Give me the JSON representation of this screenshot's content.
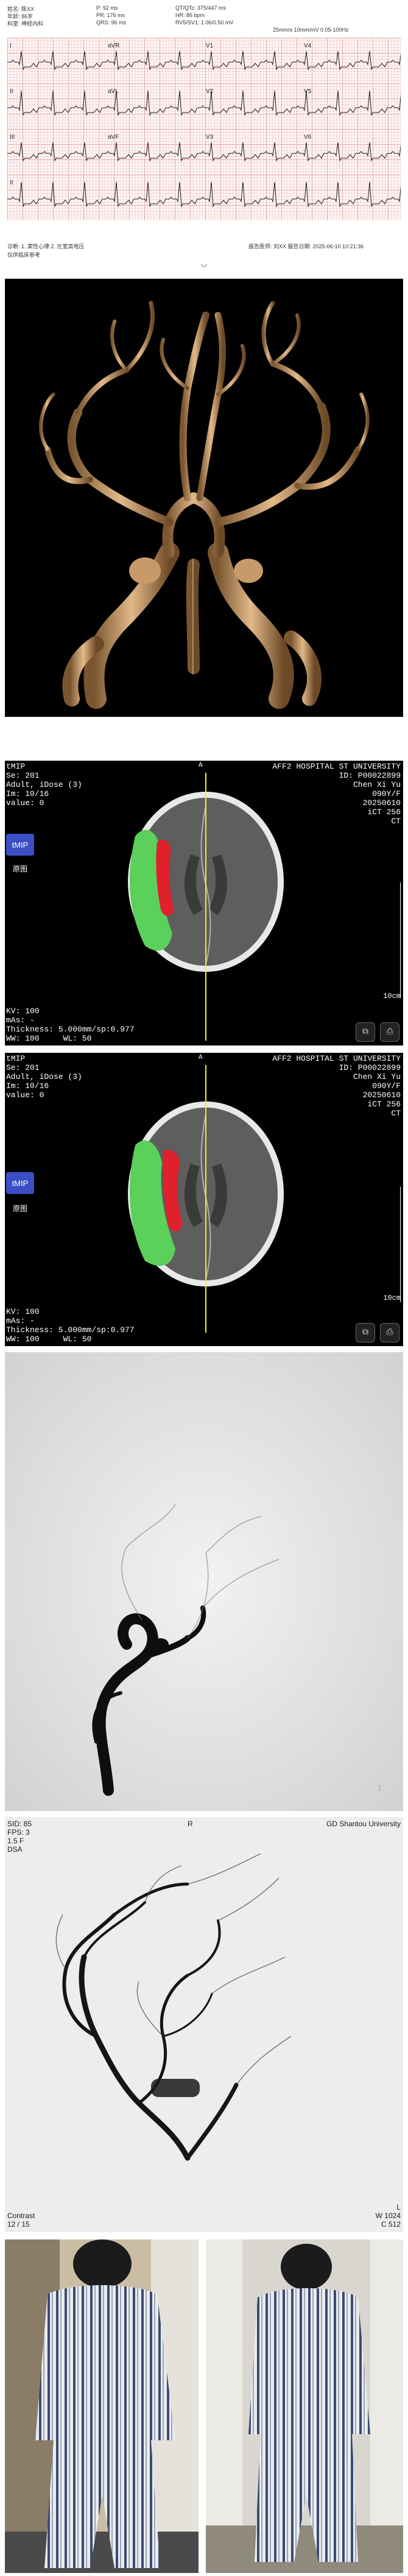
{
  "ecg": {
    "header": [
      "姓名: 陈XX",
      "年龄: 86岁",
      "科室: 神经内科",
      "P: 92 ms",
      "PR: 176 ms",
      "QRS: 96 ms",
      "QT/QTc: 375/447 ms",
      "HR: 86 bpm",
      "RV5/SV1: 1.06/0.50 mV",
      "25mm/s  10mm/mV  0.05-100Hz"
    ],
    "leads": [
      "I",
      "II",
      "III",
      "aVR",
      "aVL",
      "aVF",
      "V1",
      "V2",
      "V3",
      "V4",
      "V5",
      "V6",
      "II"
    ],
    "footer_left": "诊断: 1. 窦性心律  2. 左室高电压",
    "footer_note": "仅供临床参考",
    "footer_right": "报告医师: 刘XX    报告日期: 2025-06-10 10:21:36"
  },
  "ct_panels": [
    {
      "mode": "tMIP",
      "series": "Se: 201",
      "patient_type": "Adult, iDose (3)",
      "image_number": "Im: 10/16",
      "value": "value: 0",
      "hospital": "AFF2 HOSPITAL ST UNIVERSITY",
      "patient_id": "ID: P00022899",
      "patient_name": "Chen Xi Yu",
      "age_sex": "090Y/F",
      "study_date": "20250610",
      "scanner": "iCT 256",
      "modality": "CT",
      "orientation_top": "A",
      "kv": "KV: 100",
      "ma": "mAs: -",
      "thickness": "Thickness: 5.000mm/sp:0.977",
      "window": "WW: 100     WL: 50",
      "scale_label": "10cm",
      "btn_tmip": "tMIP",
      "btn_orig": "原图"
    },
    {
      "mode": "tMIP",
      "series": "Se: 201",
      "patient_type": "Adult, iDose (3)",
      "image_number": "Im: 10/16",
      "value": "value: 0",
      "hospital": "AFF2 HOSPITAL ST UNIVERSITY",
      "patient_id": "ID: P00022899",
      "patient_name": "Chen Xi Yu",
      "age_sex": "090Y/F",
      "study_date": "20250610",
      "scanner": "iCT 256",
      "modality": "CT",
      "orientation_top": "A",
      "kv": "KV: 100",
      "ma": "mAs: -",
      "thickness": "Thickness: 5.000mm/sp:0.977",
      "window": "WW: 100     WL: 50",
      "scale_label": "10cm",
      "btn_tmip": "tMIP",
      "btn_orig": "原图"
    }
  ],
  "dsa2": {
    "top_left": "SID: 85\nFPS: 3\n1.5 F\nDSA",
    "top_right": "GD Shantou University",
    "orientation": "R",
    "bottom_left": "Contrast\n12 / 15",
    "bottom_right": "L\nW 1024\nC 512"
  },
  "colors": {
    "ecg_trace": "#1a1a1a",
    "ct_lesion_core": "#e0202a",
    "ct_lesion_penumbra": "#5bd05b",
    "ct_midline": "#f0e53c",
    "ct_button": "#3a4fc6",
    "vessel_3d": "#c89a6a"
  }
}
